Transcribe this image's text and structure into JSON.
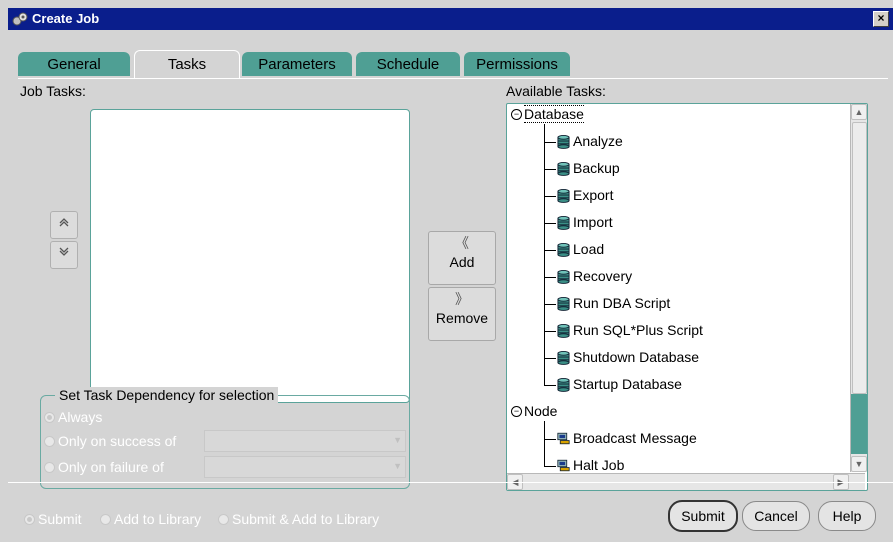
{
  "window": {
    "title": "Create Job",
    "close": "×"
  },
  "tabs": [
    {
      "label": "General",
      "active": false
    },
    {
      "label": "Tasks",
      "active": true
    },
    {
      "label": "Parameters",
      "active": false
    },
    {
      "label": "Schedule",
      "active": false
    },
    {
      "label": "Permissions",
      "active": false
    }
  ],
  "job_tasks": {
    "label": "Job Tasks:",
    "items": []
  },
  "reorder": {
    "up_icon": "chevron-double-up-icon",
    "down_icon": "chevron-double-down-icon"
  },
  "actions": {
    "add": "Add",
    "remove": "Remove"
  },
  "dependency": {
    "legend": "Set Task Dependency for selection",
    "always": "Always",
    "on_success": "Only on success of",
    "on_failure": "Only on failure of",
    "selected": "Always"
  },
  "available": {
    "label": "Available Tasks:",
    "database": {
      "label": "Database",
      "items": [
        "Analyze",
        "Backup",
        "Export",
        "Import",
        "Load",
        "Recovery",
        "Run DBA Script",
        "Run SQL*Plus Script",
        "Shutdown Database",
        "Startup Database"
      ]
    },
    "node": {
      "label": "Node",
      "items": [
        "Broadcast Message",
        "Halt Job"
      ]
    }
  },
  "submit_mode": {
    "options": [
      "Submit",
      "Add to Library",
      "Submit & Add to Library"
    ],
    "selected": "Submit"
  },
  "buttons": {
    "submit": "Submit",
    "cancel": "Cancel",
    "help": "Help"
  },
  "colors": {
    "title_bar": "#0a1e8c",
    "tab": "#4f9f94",
    "panel": "#d4d4d4",
    "accent": "#5aa39a"
  }
}
